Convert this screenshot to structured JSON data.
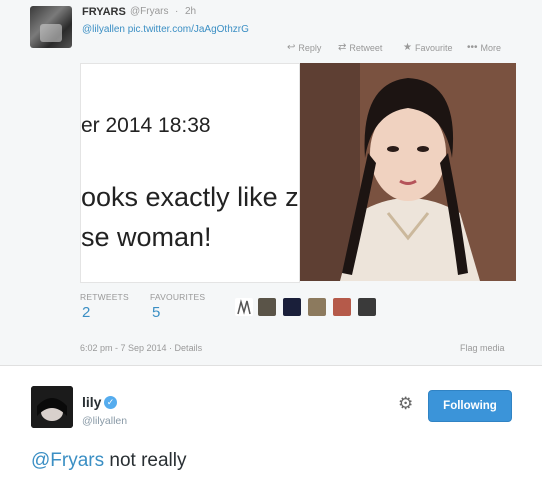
{
  "tweet": {
    "name": "FRYARS",
    "handle": "@Fryars",
    "dot": "·",
    "age": "2h",
    "mention": "@lilyallen",
    "link": "pic.twitter.com/JaAgOthzrG",
    "actions": {
      "reply": "Reply",
      "retweet": "Retweet",
      "favourite": "Favourite",
      "more": "More"
    },
    "screenshot_text": {
      "line1": "er 2014 18:38",
      "line2": "ooks exactly like z",
      "line3": "se woman!"
    },
    "stats": {
      "retweets_label": "RETWEETS",
      "retweets_value": "2",
      "favourites_label": "FAVOURITES",
      "favourites_value": "5"
    },
    "timestamp": "6:02 pm - 7 Sep 2014 · Details",
    "flag_media": "Flag media"
  },
  "reply": {
    "name": "lily",
    "handle": "@lilyallen",
    "follow_label": "Following",
    "mention": "@Fryars",
    "text": " not really"
  },
  "colors": {
    "link": "#3b8fc4",
    "follow_button": "#3b94d9",
    "verified": "#55acee"
  }
}
